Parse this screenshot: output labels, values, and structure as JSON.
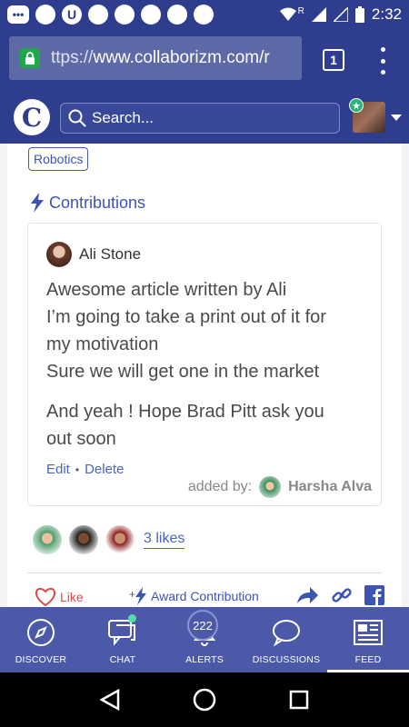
{
  "status_bar": {
    "time": "2:32",
    "signal_label": "R",
    "icons": [
      "message-icon",
      "circle-icon",
      "u-app-icon",
      "circle-icon",
      "circle-icon",
      "circle-icon",
      "circle-icon",
      "circle-icon",
      "circle-icon",
      "circle-icon"
    ]
  },
  "browser": {
    "url_prefix": "ttps://",
    "url_host": "www.collaborizm.com/r",
    "tab_count": "1"
  },
  "header": {
    "logo_text": "C",
    "search_placeholder": "Search..."
  },
  "post": {
    "tag": "Robotics",
    "contributions_title": "Contributions",
    "contribution": {
      "author": "Ali Stone",
      "lines_1": [
        "Awesome article written by Ali",
        "I’m going to take a print out of it for my motivation",
        "Sure we will get one in the market"
      ],
      "line_1a": "Awesome article written by Ali",
      "line_1b": "I’m going to take a print out of it for",
      "line_1c": "my motivation",
      "line_1d": "Sure we will get one in the market",
      "line_2a": "And yeah ! Hope Brad Pitt ask you",
      "line_2b": "out soon",
      "edit_label": "Edit",
      "separator": "•",
      "delete_label": "Delete",
      "added_by_label": "added by:",
      "added_by_name": "Harsha Alva"
    },
    "likes_label": "3 likes",
    "like_button": "Like",
    "award_button": "Award Contribution"
  },
  "bottom_nav": {
    "items": [
      {
        "label": "DISCOVER",
        "icon": "compass-icon"
      },
      {
        "label": "CHAT",
        "icon": "chat-icon"
      },
      {
        "label": "ALERTS",
        "icon": "bell-icon"
      },
      {
        "label": "DISCUSSIONS",
        "icon": "speech-bubble-icon"
      },
      {
        "label": "FEED",
        "icon": "newspaper-icon"
      }
    ],
    "alerts_badge": "222",
    "active": "FEED"
  },
  "colors": {
    "brand": "#2f3d8f",
    "nav": "#4b59a8",
    "link": "#3e54b3",
    "like": "#d94b4b",
    "online": "#4ee0a0"
  }
}
